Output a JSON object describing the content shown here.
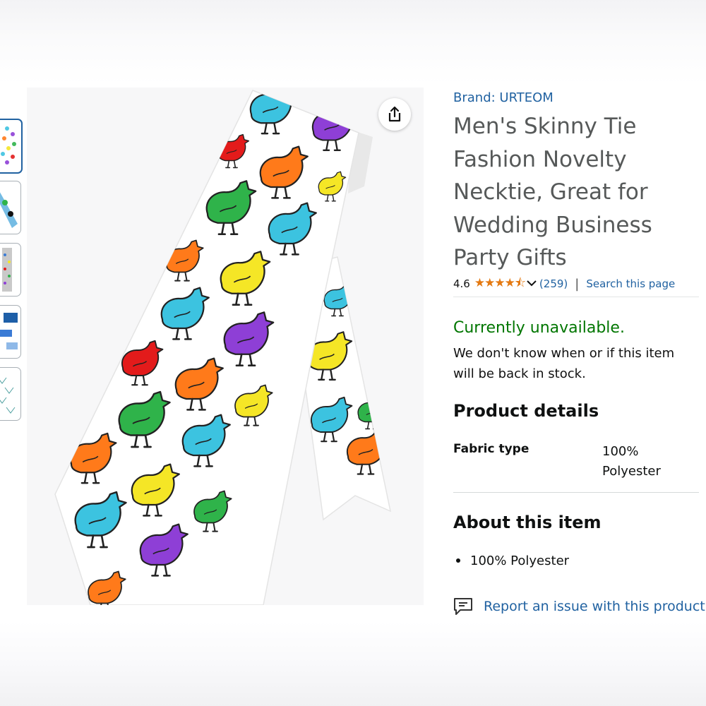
{
  "product": {
    "brand": "Brand: URTEOM",
    "title": "Men's Skinny Tie Fashion Novelty Necktie, Great for Wedding Business Party Gifts"
  },
  "rating": {
    "value": "4.6",
    "stars": "★★★★⯪",
    "review_count": "(259)",
    "separator": "|",
    "search_link": "Search this page"
  },
  "availability": {
    "status": "Currently unavailable.",
    "note": "We don't know when or if this item will be back in stock."
  },
  "product_details": {
    "heading": "Product details",
    "rows": [
      {
        "label": "Fabric type",
        "value": "100% Polyester"
      }
    ]
  },
  "about": {
    "heading": "About this item",
    "bullets": [
      "100% Polyester"
    ]
  },
  "report_link": "Report an issue with this product",
  "icons": {
    "share": "share-icon",
    "report": "report-flag-icon",
    "rating_dropdown": "chevron-down-icon"
  },
  "colors": {
    "link": "#2162a1",
    "available_status": "#007600",
    "stars": "#e47911",
    "title": "#565959",
    "thumbnail_selected": "#2162a1"
  },
  "gallery": {
    "thumbnail_count": 5,
    "selected_index": 0
  }
}
